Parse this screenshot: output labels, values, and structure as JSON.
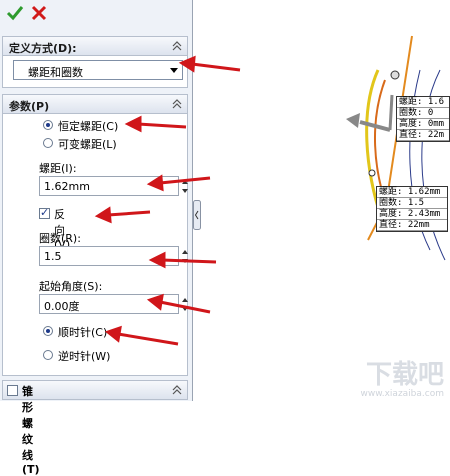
{
  "toolbar": {
    "ok_icon": "check-icon",
    "cancel_icon": "x-icon"
  },
  "definition": {
    "title": "定义方式(D):",
    "selected": "螺距和圈数"
  },
  "params": {
    "title": "参数(P)",
    "pitch_mode": {
      "constant": "恒定螺距(C)",
      "variable": "可变螺距(L)"
    },
    "pitch_label": "螺距(I):",
    "pitch_value": "1.62mm",
    "reverse_label": "反向(V)",
    "revolutions_label": "圈数(R):",
    "revolutions_value": "1.5",
    "start_angle_label": "起始角度(S):",
    "start_angle_value": "0.00度",
    "clockwise": "顺时针(C)",
    "counterclockwise": "逆时针(W)"
  },
  "tapered": {
    "title": "锥形螺纹线(T)"
  },
  "callout_top": [
    "螺距: 1.6",
    "圈数: 0",
    "高度: 0mm",
    "直径: 22m"
  ],
  "callout_bottom": [
    "螺距: 1.62mm",
    "圈数: 1.5",
    "高度: 2.43mm",
    "直径: 22mm"
  ],
  "watermark": {
    "main": "下载吧",
    "sub": "www.xiazaiba.com"
  },
  "colors": {
    "accent_arrow": "#d0161a",
    "ok_green": "#2e9b2e",
    "cancel_red": "#d11a1a"
  }
}
